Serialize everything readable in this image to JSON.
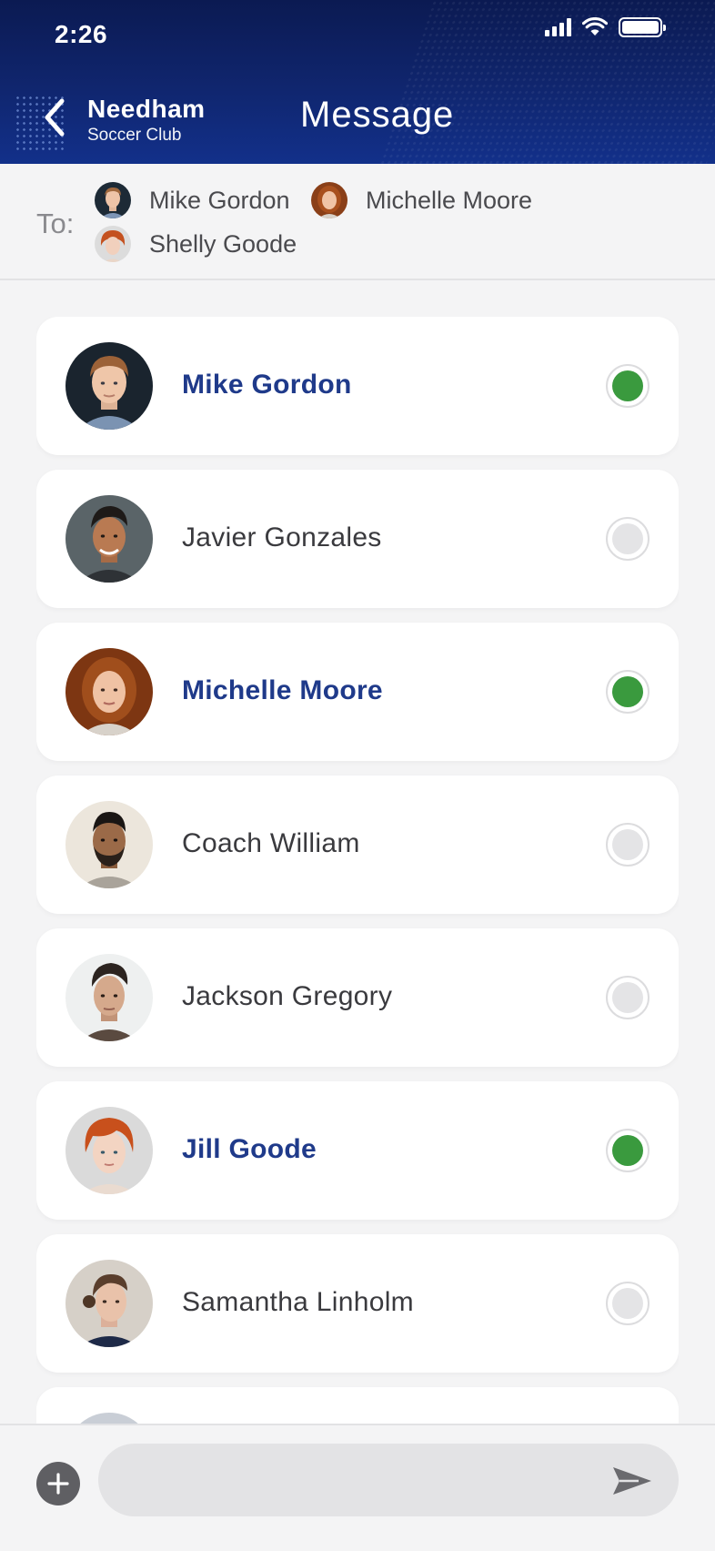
{
  "status_bar": {
    "time": "2:26"
  },
  "header": {
    "club_name_line1": "Needham",
    "club_name_line2": "Soccer Club",
    "title": "Message",
    "back_icon": "chevron-left-icon"
  },
  "to_bar": {
    "label": "To:",
    "recipients": [
      {
        "name": "Mike Gordon"
      },
      {
        "name": "Michelle Moore"
      },
      {
        "name": "Shelly Goode"
      }
    ]
  },
  "contacts": [
    {
      "name": "Mike Gordon",
      "selected": true
    },
    {
      "name": "Javier Gonzales",
      "selected": false
    },
    {
      "name": "Michelle Moore",
      "selected": true
    },
    {
      "name": "Coach William",
      "selected": false
    },
    {
      "name": "Jackson Gregory",
      "selected": false
    },
    {
      "name": "Jill Goode",
      "selected": true
    },
    {
      "name": "Samantha Linholm",
      "selected": false
    }
  ],
  "composer": {
    "placeholder": "",
    "add_icon": "plus-icon",
    "send_icon": "send-icon"
  },
  "colors": {
    "header_bg": "#10266f",
    "selected_name": "#1f3a8a",
    "selected_radio": "#3a9a3e",
    "unselected_radio": "#e4e4e6"
  }
}
